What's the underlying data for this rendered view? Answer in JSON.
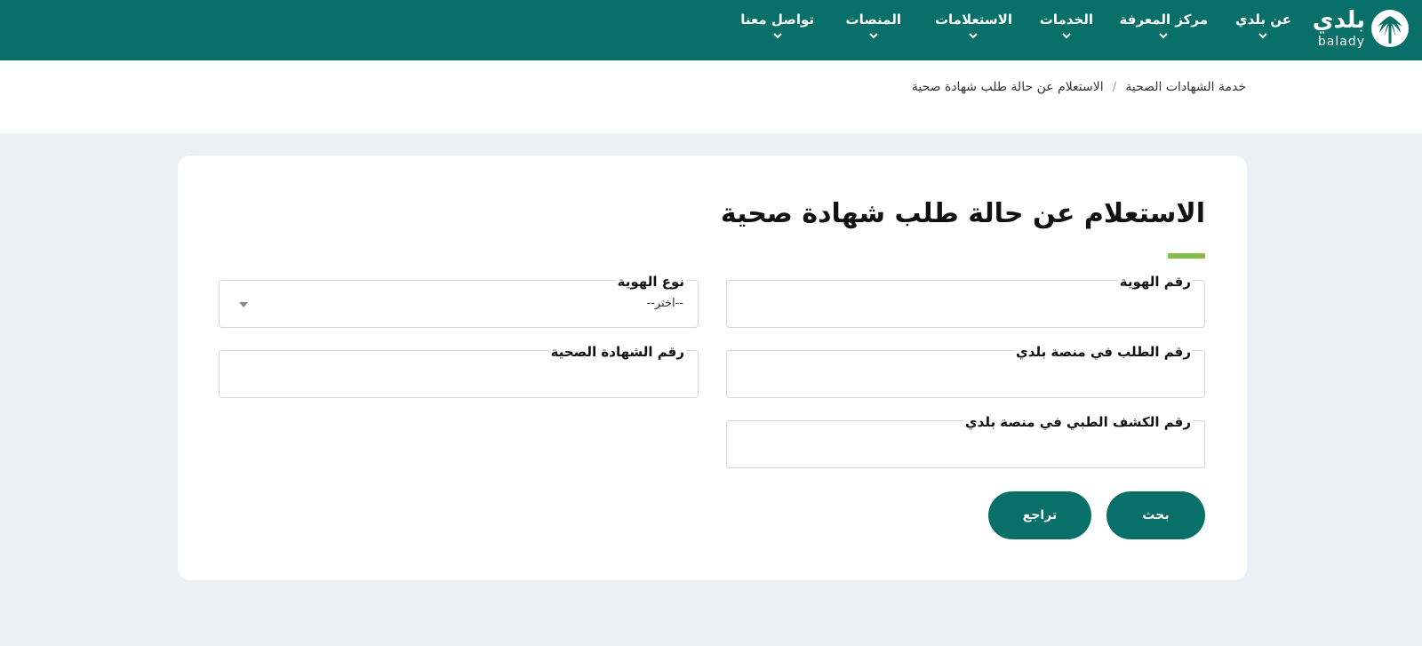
{
  "header": {
    "logo": {
      "arabic": "بلدي",
      "latin": "balady"
    },
    "nav": [
      {
        "label": "عن بلدي"
      },
      {
        "label": "مركز المعرفة"
      },
      {
        "label": "الخدمات"
      },
      {
        "label": "الاستعلامات"
      },
      {
        "label": "المنصات"
      },
      {
        "label": "تواصل معنا"
      }
    ]
  },
  "breadcrumb": {
    "items": [
      "خدمة الشهادات الصحية",
      "الاستعلام عن حالة طلب شهادة صحية"
    ],
    "separator": "/"
  },
  "form": {
    "title": "الاستعلام عن حالة طلب شهادة صحية",
    "fields": {
      "id_number": {
        "label": "رقم الهوية",
        "value": ""
      },
      "id_type": {
        "label": "نوع الهوية",
        "value": "--اختر--"
      },
      "request_number": {
        "label": "رقم الطلب في منصة بلدي",
        "value": ""
      },
      "certificate_number": {
        "label": "رقم الشهادة الصحية",
        "value": ""
      },
      "medical_exam_number": {
        "label": "رقم الكشف الطبي في منصة بلدي",
        "value": ""
      }
    },
    "buttons": {
      "search": "بحث",
      "back": "تراجع"
    }
  },
  "colors": {
    "primary": "#087069",
    "accent": "#84bd41",
    "page_bg": "#eceff3"
  }
}
